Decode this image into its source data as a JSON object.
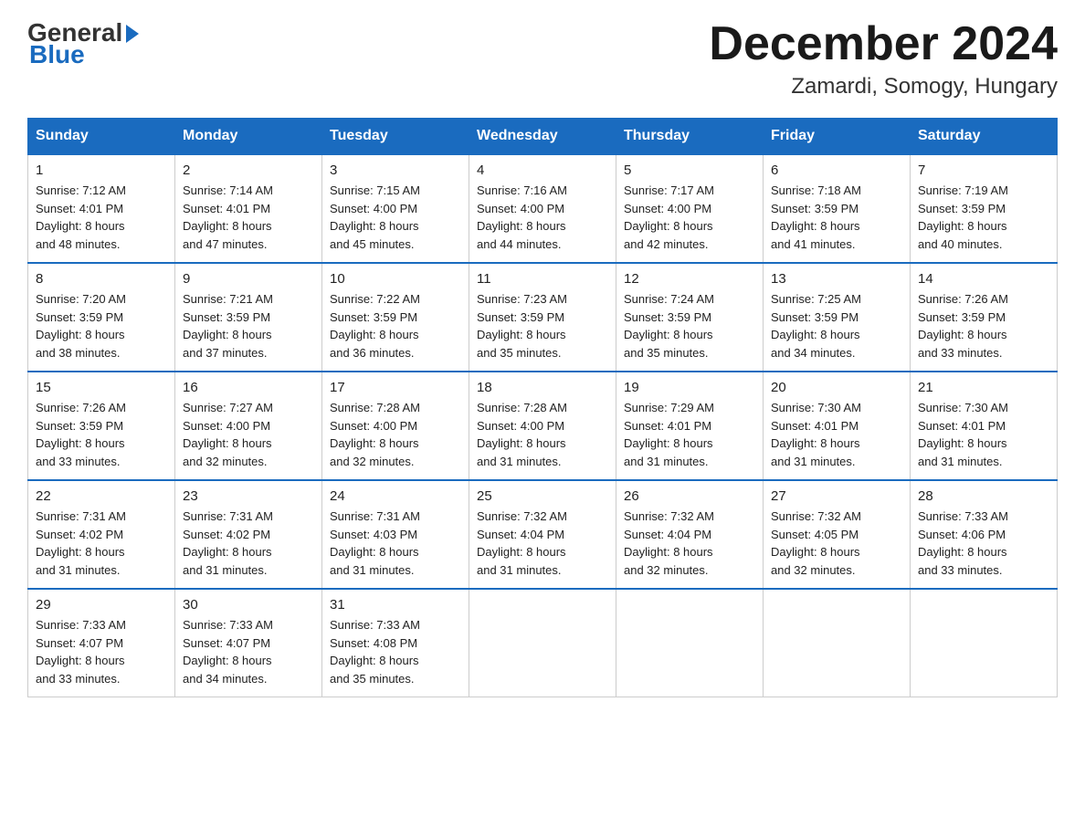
{
  "logo": {
    "general": "General",
    "blue": "Blue"
  },
  "header": {
    "month_year": "December 2024",
    "location": "Zamardi, Somogy, Hungary"
  },
  "days_of_week": [
    "Sunday",
    "Monday",
    "Tuesday",
    "Wednesday",
    "Thursday",
    "Friday",
    "Saturday"
  ],
  "weeks": [
    [
      {
        "day": "1",
        "sunrise": "7:12 AM",
        "sunset": "4:01 PM",
        "daylight": "8 hours and 48 minutes."
      },
      {
        "day": "2",
        "sunrise": "7:14 AM",
        "sunset": "4:01 PM",
        "daylight": "8 hours and 47 minutes."
      },
      {
        "day": "3",
        "sunrise": "7:15 AM",
        "sunset": "4:00 PM",
        "daylight": "8 hours and 45 minutes."
      },
      {
        "day": "4",
        "sunrise": "7:16 AM",
        "sunset": "4:00 PM",
        "daylight": "8 hours and 44 minutes."
      },
      {
        "day": "5",
        "sunrise": "7:17 AM",
        "sunset": "4:00 PM",
        "daylight": "8 hours and 42 minutes."
      },
      {
        "day": "6",
        "sunrise": "7:18 AM",
        "sunset": "3:59 PM",
        "daylight": "8 hours and 41 minutes."
      },
      {
        "day": "7",
        "sunrise": "7:19 AM",
        "sunset": "3:59 PM",
        "daylight": "8 hours and 40 minutes."
      }
    ],
    [
      {
        "day": "8",
        "sunrise": "7:20 AM",
        "sunset": "3:59 PM",
        "daylight": "8 hours and 38 minutes."
      },
      {
        "day": "9",
        "sunrise": "7:21 AM",
        "sunset": "3:59 PM",
        "daylight": "8 hours and 37 minutes."
      },
      {
        "day": "10",
        "sunrise": "7:22 AM",
        "sunset": "3:59 PM",
        "daylight": "8 hours and 36 minutes."
      },
      {
        "day": "11",
        "sunrise": "7:23 AM",
        "sunset": "3:59 PM",
        "daylight": "8 hours and 35 minutes."
      },
      {
        "day": "12",
        "sunrise": "7:24 AM",
        "sunset": "3:59 PM",
        "daylight": "8 hours and 35 minutes."
      },
      {
        "day": "13",
        "sunrise": "7:25 AM",
        "sunset": "3:59 PM",
        "daylight": "8 hours and 34 minutes."
      },
      {
        "day": "14",
        "sunrise": "7:26 AM",
        "sunset": "3:59 PM",
        "daylight": "8 hours and 33 minutes."
      }
    ],
    [
      {
        "day": "15",
        "sunrise": "7:26 AM",
        "sunset": "3:59 PM",
        "daylight": "8 hours and 33 minutes."
      },
      {
        "day": "16",
        "sunrise": "7:27 AM",
        "sunset": "4:00 PM",
        "daylight": "8 hours and 32 minutes."
      },
      {
        "day": "17",
        "sunrise": "7:28 AM",
        "sunset": "4:00 PM",
        "daylight": "8 hours and 32 minutes."
      },
      {
        "day": "18",
        "sunrise": "7:28 AM",
        "sunset": "4:00 PM",
        "daylight": "8 hours and 31 minutes."
      },
      {
        "day": "19",
        "sunrise": "7:29 AM",
        "sunset": "4:01 PM",
        "daylight": "8 hours and 31 minutes."
      },
      {
        "day": "20",
        "sunrise": "7:30 AM",
        "sunset": "4:01 PM",
        "daylight": "8 hours and 31 minutes."
      },
      {
        "day": "21",
        "sunrise": "7:30 AM",
        "sunset": "4:01 PM",
        "daylight": "8 hours and 31 minutes."
      }
    ],
    [
      {
        "day": "22",
        "sunrise": "7:31 AM",
        "sunset": "4:02 PM",
        "daylight": "8 hours and 31 minutes."
      },
      {
        "day": "23",
        "sunrise": "7:31 AM",
        "sunset": "4:02 PM",
        "daylight": "8 hours and 31 minutes."
      },
      {
        "day": "24",
        "sunrise": "7:31 AM",
        "sunset": "4:03 PM",
        "daylight": "8 hours and 31 minutes."
      },
      {
        "day": "25",
        "sunrise": "7:32 AM",
        "sunset": "4:04 PM",
        "daylight": "8 hours and 31 minutes."
      },
      {
        "day": "26",
        "sunrise": "7:32 AM",
        "sunset": "4:04 PM",
        "daylight": "8 hours and 32 minutes."
      },
      {
        "day": "27",
        "sunrise": "7:32 AM",
        "sunset": "4:05 PM",
        "daylight": "8 hours and 32 minutes."
      },
      {
        "day": "28",
        "sunrise": "7:33 AM",
        "sunset": "4:06 PM",
        "daylight": "8 hours and 33 minutes."
      }
    ],
    [
      {
        "day": "29",
        "sunrise": "7:33 AM",
        "sunset": "4:07 PM",
        "daylight": "8 hours and 33 minutes."
      },
      {
        "day": "30",
        "sunrise": "7:33 AM",
        "sunset": "4:07 PM",
        "daylight": "8 hours and 34 minutes."
      },
      {
        "day": "31",
        "sunrise": "7:33 AM",
        "sunset": "4:08 PM",
        "daylight": "8 hours and 35 minutes."
      },
      null,
      null,
      null,
      null
    ]
  ],
  "labels": {
    "sunrise": "Sunrise:",
    "sunset": "Sunset:",
    "daylight": "Daylight:"
  }
}
